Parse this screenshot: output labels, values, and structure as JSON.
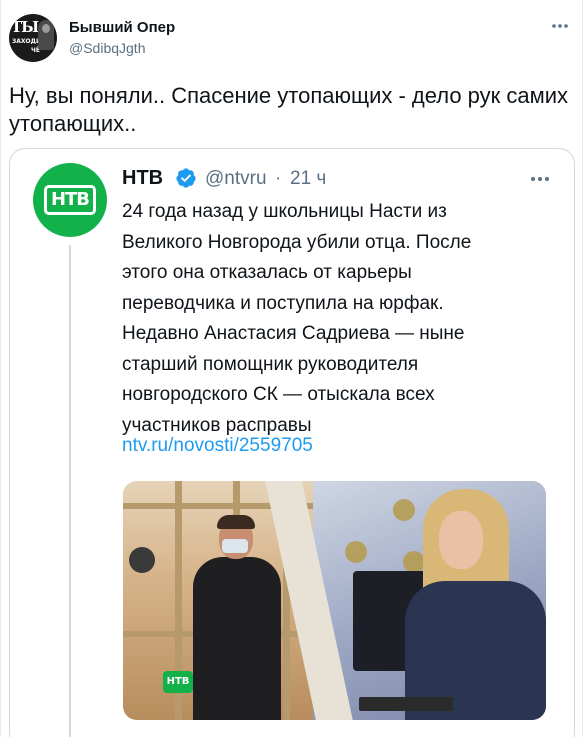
{
  "tweet": {
    "author_name": "Бывший Опер",
    "author_handle": "@SdibqJgth",
    "avatar": {
      "text_big": "ТЫ",
      "text_mid": "ЗАХОДИ",
      "text_low": "ЧЁ"
    },
    "more_icon": "more-dots-icon",
    "text": "Ну, вы поняли.. Спасение утопающих - дело рук самих утопающих.."
  },
  "quoted_tweet": {
    "author_name": "НТВ",
    "verified_icon": "verified-badge-icon",
    "author_handle": "@ntvru",
    "separator": "·",
    "time": "21 ч",
    "avatar_logo": "НТВ",
    "more_icon": "more-dots-icon",
    "text_lines": [
      "24 года назад у школьницы Насти из",
      "Великого Новгорода убили отца. После",
      "этого она отказалась от карьеры",
      "переводчика и поступила на юрфак.",
      "Недавно Анастасия Садриева — ныне",
      "старший помощник руководителя",
      "новгородского СК — отыскала всех",
      "участников расправы"
    ],
    "link": "ntv.ru/novosti/2559705",
    "media_badge": "НТВ"
  },
  "colors": {
    "text": "#0f1419",
    "secondary": "#5b7083",
    "link": "#1d9bf0",
    "verified": "#1d9bf0",
    "ntv_green": "#12b14a",
    "border": "#cfd9de"
  }
}
